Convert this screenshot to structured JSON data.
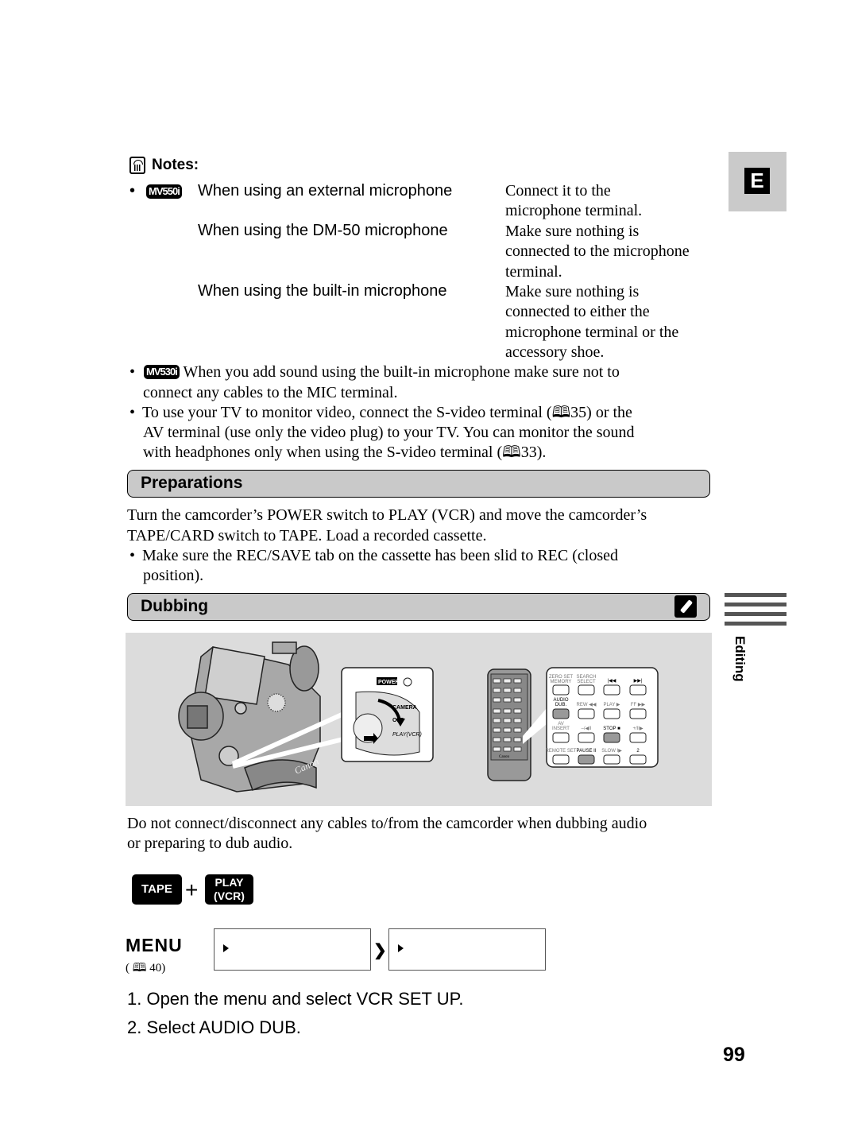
{
  "side_tab": {
    "letter": "E"
  },
  "notes": {
    "heading": "Notes:",
    "icon": "notes-icon",
    "bullet": "•",
    "mic_rows": {
      "model_badge": "MV550i",
      "rows": [
        {
          "condition": "When using an external microphone",
          "instruction_lines": [
            "Connect it to the",
            "microphone terminal."
          ]
        },
        {
          "condition": "When using the DM-50 microphone",
          "instruction_lines": [
            "Make sure nothing is",
            "connected to the microphone",
            "terminal."
          ]
        },
        {
          "condition": "When using the built-in microphone",
          "instruction_lines": [
            "Make sure nothing is",
            "connected to either the",
            "microphone terminal or the",
            "accessory shoe."
          ]
        }
      ]
    },
    "item2": {
      "model_badge": "MV530i",
      "line1": "When you add sound using the built-in microphone make sure not to",
      "line2": "connect any cables to the MIC terminal."
    },
    "item3": {
      "line1a": "To use your TV to monitor video, connect the S-video terminal (",
      "ref1": "35",
      "line1b": ") or the",
      "line2": "AV terminal (use only the video plug) to your TV. You can monitor the sound",
      "line3a": "with headphones only when using the S-video terminal (",
      "ref2": "33",
      "line3b": ")."
    }
  },
  "preparations": {
    "title": "Preparations",
    "line1": "Turn the camcorder’s POWER switch to PLAY (VCR) and move the camcorder’s",
    "line2": "TAPE/CARD switch to TAPE. Load a recorded cassette.",
    "bullet_line1": "Make sure the REC/SAVE tab on the cassette has been slid to REC (closed",
    "bullet_line2": "position)."
  },
  "dubbing": {
    "title": "Dubbing",
    "icon": "remote-control-icon",
    "illustration": {
      "camcorder_brand": "Canon",
      "power_label": "POWER",
      "switch_positions": [
        "CAMERA",
        "OFF",
        "PLAY(VCR)"
      ],
      "remote_brand": "Canon",
      "remote_buttons": [
        "ZERO SET MEMORY",
        "SEARCH SELECT",
        "|◀◀",
        "▶▶|",
        "AUDIO DUB.",
        "REW ◀◀",
        "PLAY ▶",
        "FF ▶▶",
        "AV INSERT",
        "–/◀II",
        "STOP ■",
        "+/II▶",
        "REMOTE SET",
        "PAUSE II",
        "SLOW I▶",
        "2"
      ],
      "highlighted_buttons": [
        "AUDIO DUB.",
        "STOP ■",
        "PAUSE II"
      ]
    },
    "warning_line1": "Do not connect/disconnect any cables to/from the camcorder when dubbing audio",
    "warning_line2": "or preparing to dub audio.",
    "mode": {
      "tape": "TAPE",
      "plus": "+",
      "play_line1": "PLAY",
      "play_line2": "(VCR)"
    },
    "menu": {
      "word": "MENU",
      "ref_open": "(",
      "ref_page": "40)",
      "box1": "",
      "box2": ""
    },
    "steps": [
      "1.  Open the menu and select VCR SET UP.",
      "2.  Select AUDIO DUB."
    ]
  },
  "side_section": {
    "label": "Editing"
  },
  "page_number": "99"
}
